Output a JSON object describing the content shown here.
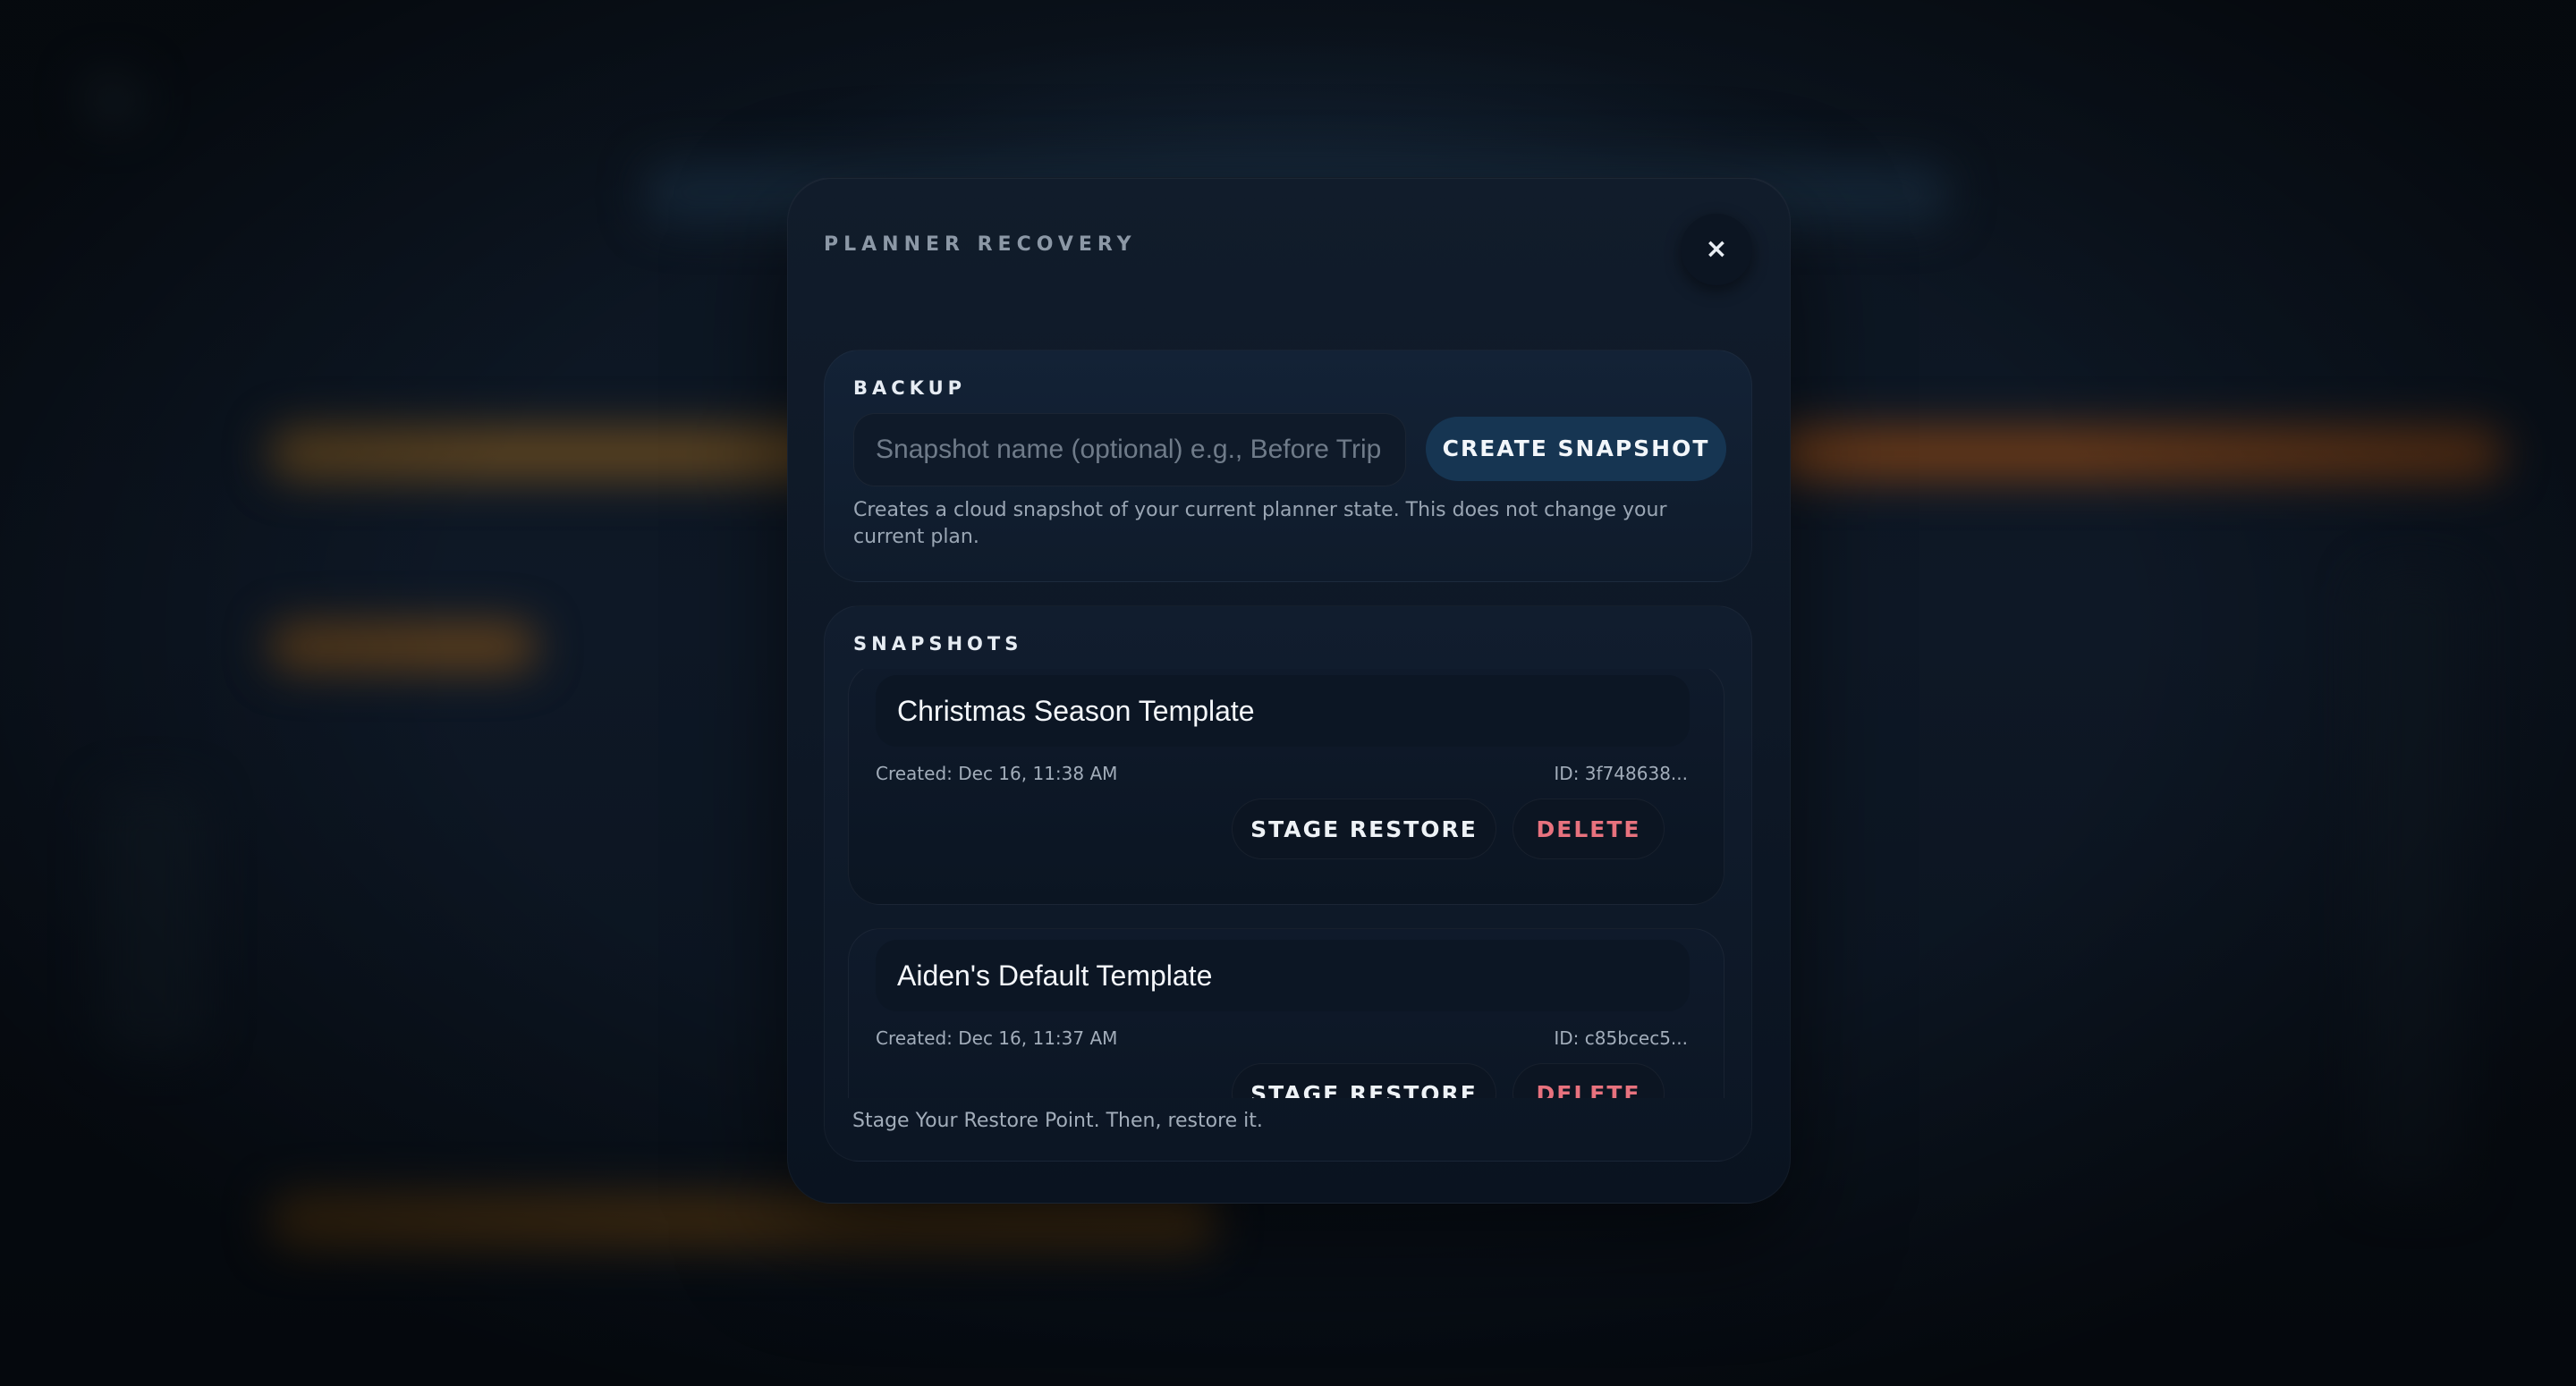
{
  "modal": {
    "title": "PLANNER RECOVERY",
    "close_label": "×"
  },
  "backup": {
    "label": "BACKUP",
    "input_value": "",
    "input_placeholder": "Snapshot name (optional) e.g., Before Trip",
    "create_label": "CREATE SNAPSHOT",
    "note": "Creates a cloud snapshot of your current planner state. This does not change your current plan."
  },
  "snapshots": {
    "label": "SNAPSHOTS",
    "items": [
      {
        "name": "Christmas Season Template",
        "created": "Created: Dec 16, 11:38 AM",
        "id": "ID: 3f748638...",
        "stage_label": "STAGE RESTORE",
        "delete_label": "DELETE"
      },
      {
        "name": "Aiden's Default Template",
        "created": "Created: Dec 16, 11:37 AM",
        "id": "ID: c85bcec5...",
        "stage_label": "STAGE RESTORE",
        "delete_label": "DELETE"
      }
    ]
  },
  "footer": {
    "note": "Stage Your Restore Point. Then, restore it."
  },
  "colors": {
    "accent_button": "#163552",
    "delete_text": "#e8727e",
    "background_orange_glow": "#c97a1c"
  }
}
